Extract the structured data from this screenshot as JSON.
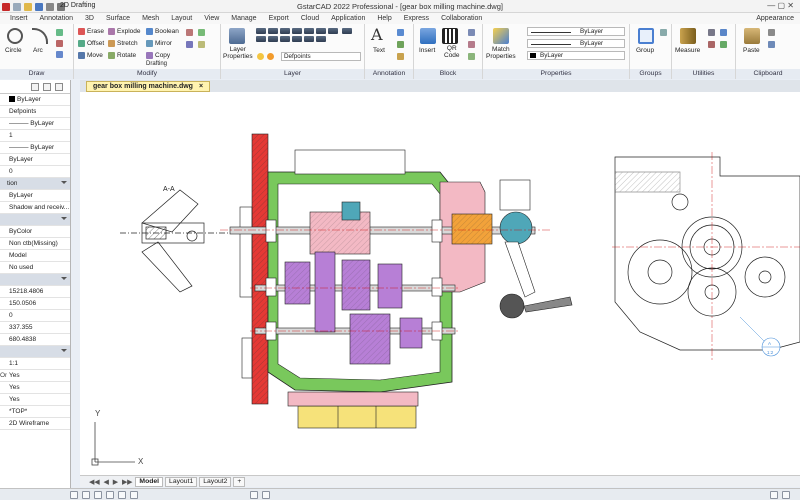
{
  "window": {
    "title": "GstarCAD 2022 Professional - [gear box milling machine.dwg]",
    "workspace": "2D Drafting",
    "controls": "—  ▢  ✕"
  },
  "ribbon_tabs": [
    "Insert",
    "Annotation",
    "3D",
    "Surface",
    "Mesh",
    "Layout",
    "View",
    "Manage",
    "Export",
    "Cloud",
    "Application",
    "Help",
    "Express",
    "Collaboration",
    "Appearance"
  ],
  "ribbon": {
    "draw": {
      "label": "Draw",
      "circle": "Circle",
      "arc": "Arc"
    },
    "modify": {
      "label": "Modify",
      "tools": [
        "Erase",
        "Explode",
        "Boolean",
        "Offset",
        "Stretch",
        "Mirror",
        "Move",
        "Rotate",
        "Copy",
        "Drafting"
      ]
    },
    "layer": {
      "label": "Layer",
      "properties": "Layer\nProperties",
      "current": "Defpoints"
    },
    "annotation": {
      "label": "Annotation",
      "text": "Text"
    },
    "block": {
      "label": "Block",
      "insert": "Insert",
      "qr": "QR\nCode"
    },
    "properties": {
      "label": "Properties",
      "match": "Match\nProperties",
      "color": "ByLayer",
      "linetype": "ByLayer",
      "lineweight": "ByLayer"
    },
    "groups": {
      "label": "Groups",
      "group": "Group"
    },
    "utilities": {
      "label": "Utilities",
      "measure": "Measure"
    },
    "clipboard": {
      "label": "Clipboard",
      "paste": "Paste"
    }
  },
  "document_tab": {
    "name": "gear box milling machine.dwg",
    "close": "×"
  },
  "properties_palette": {
    "rows": [
      {
        "k": "",
        "v": "ByLayer",
        "swatch": true
      },
      {
        "k": "",
        "v": "Defpoints"
      },
      {
        "k": "",
        "v": "——— ByLayer"
      },
      {
        "k": "",
        "v": "1"
      },
      {
        "k": "",
        "v": "——— ByLayer"
      },
      {
        "k": "",
        "v": "ByLayer"
      },
      {
        "k": "",
        "v": "0"
      },
      {
        "k": "",
        "v": "tion",
        "header": true
      },
      {
        "k": "",
        "v": "ByLayer"
      },
      {
        "k": "",
        "v": "Shadow and receiv..."
      },
      {
        "k": "",
        "v": "",
        "header": true
      },
      {
        "k": "",
        "v": "ByColor"
      },
      {
        "k": "",
        "v": "Non ctb(Missing)"
      },
      {
        "k": "",
        "v": "Model"
      },
      {
        "k": "",
        "v": "No used"
      },
      {
        "k": "",
        "v": "",
        "header": true
      },
      {
        "k": "",
        "v": "15218.4806"
      },
      {
        "k": "",
        "v": "150.0506"
      },
      {
        "k": "",
        "v": "0"
      },
      {
        "k": "",
        "v": "337.355"
      },
      {
        "k": "",
        "v": "680.4838"
      },
      {
        "k": "",
        "v": "",
        "header": true
      },
      {
        "k": "",
        "v": "1:1"
      },
      {
        "k": "On",
        "v": "Yes"
      },
      {
        "k": "",
        "v": "Yes"
      },
      {
        "k": "",
        "v": "Yes"
      },
      {
        "k": "",
        "v": "*TOP*"
      },
      {
        "k": "",
        "v": "2D Wireframe"
      }
    ]
  },
  "drawing": {
    "section_label": "A-A",
    "detail_label_top": "A",
    "detail_label_bottom": "1:2",
    "ucs_y": "Y",
    "ucs_x": "X"
  },
  "layout_tabs": {
    "nav": [
      "◀◀",
      "◀",
      "▶",
      "▶▶"
    ],
    "tabs": [
      "Model",
      "Layout1",
      "Layout2"
    ],
    "add": "+"
  },
  "colors": {
    "red": "#e53935",
    "green": "#79c85c",
    "purple": "#b77fd6",
    "pink": "#f3b9c4",
    "orange": "#f2a23a",
    "teal": "#4fa7b8",
    "yellow": "#f6e27a",
    "blue": "#4a90d9"
  }
}
